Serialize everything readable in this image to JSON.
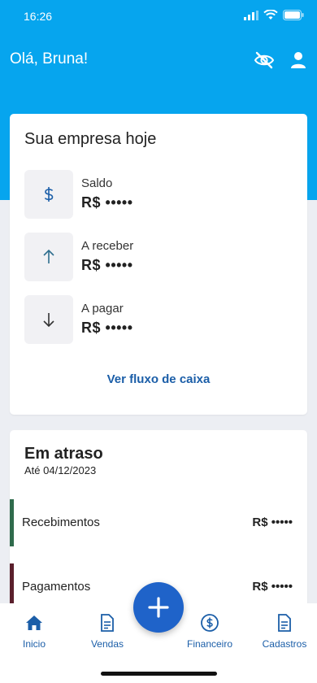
{
  "status_bar": {
    "time": "16:26"
  },
  "header": {
    "greeting": "Olá, Bruna!",
    "hide_values_icon": "eye-off-icon",
    "profile_icon": "user-icon"
  },
  "company_today": {
    "title": "Sua empresa hoje",
    "metrics": [
      {
        "label": "Saldo",
        "value": "R$ •••••",
        "icon": "dollar-icon"
      },
      {
        "label": "A receber",
        "value": "R$ •••••",
        "icon": "arrow-up-icon"
      },
      {
        "label": "A pagar",
        "value": "R$ •••••",
        "icon": "arrow-down-icon"
      }
    ],
    "link": "Ver fluxo de caixa"
  },
  "overdue": {
    "title": "Em atraso",
    "subtitle": "Até 04/12/2023",
    "rows": [
      {
        "label": "Recebimentos",
        "value": "R$ •••••",
        "color": "#2f6b4c"
      },
      {
        "label": "Pagamentos",
        "value": "R$ •••••",
        "color": "#5a1f2c"
      }
    ]
  },
  "tabbar": {
    "tabs": [
      {
        "label": "Inicio",
        "icon": "home-icon"
      },
      {
        "label": "Vendas",
        "icon": "document-icon"
      },
      {
        "label": "Financeiro",
        "icon": "dollar-circle-icon"
      },
      {
        "label": "Cadastros",
        "icon": "document-icon"
      }
    ],
    "fab_icon": "plus-icon"
  },
  "colors": {
    "primary": "#06a5ee",
    "accent": "#1f63c9",
    "link": "#1b5ea8",
    "background": "#eceef3"
  }
}
